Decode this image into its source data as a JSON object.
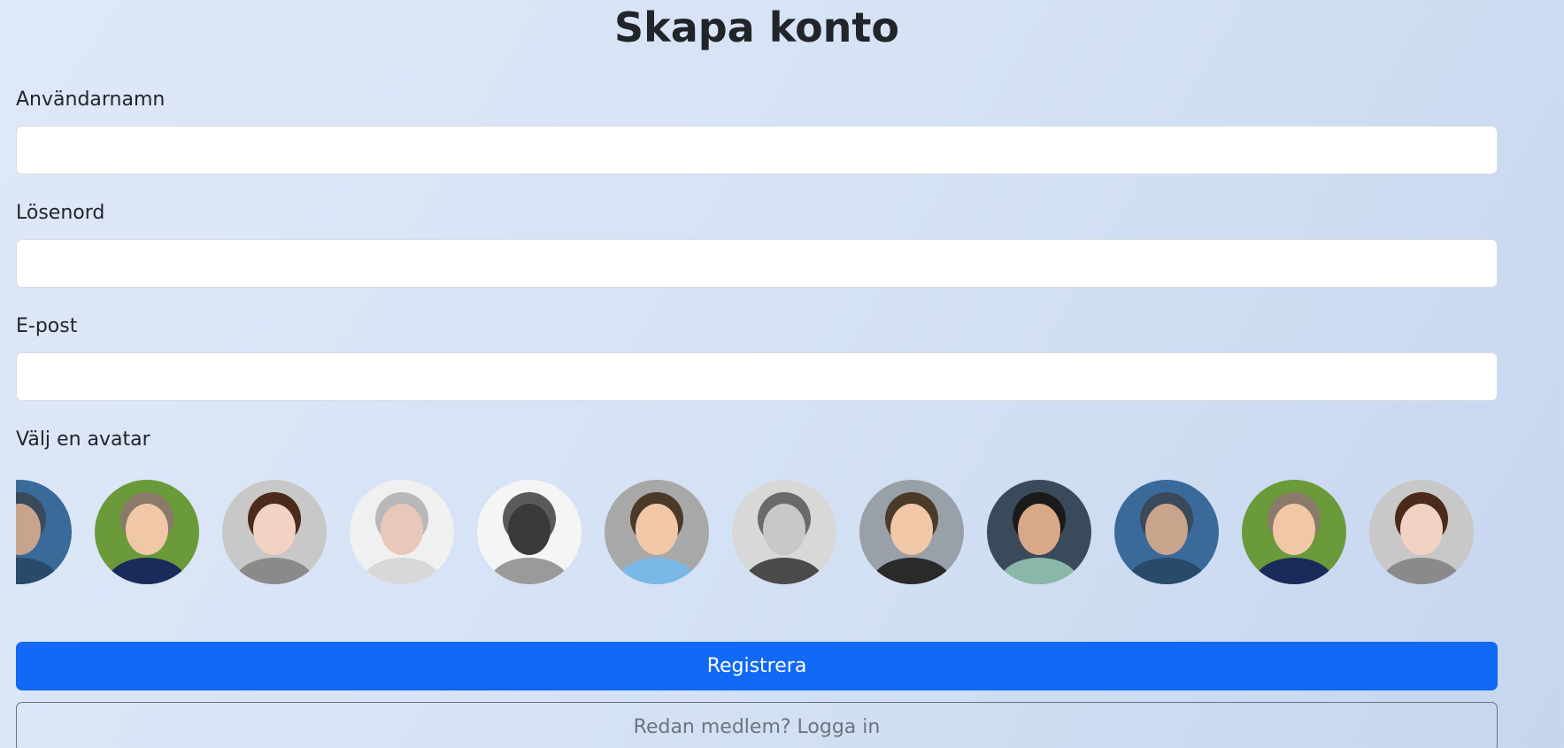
{
  "page": {
    "title": "Skapa konto"
  },
  "form": {
    "username": {
      "label": "Användarnamn",
      "value": "",
      "placeholder": ""
    },
    "password": {
      "label": "Lösenord",
      "value": "",
      "placeholder": ""
    },
    "email": {
      "label": "E-post",
      "value": "",
      "placeholder": ""
    },
    "avatar_label": "Välj en avatar",
    "avatars": [
      {
        "name": "avatar-bald-man-blue",
        "bg": "#3a6a9a",
        "skin": "#c9a48c",
        "hair": "#3a4a5a",
        "shirt": "#2a4a6a"
      },
      {
        "name": "avatar-boy-smiling",
        "bg": "#6a9a3a",
        "skin": "#f0c8a8",
        "hair": "#8a7a6a",
        "shirt": "#1a2a5a"
      },
      {
        "name": "avatar-woman-scarf",
        "bg": "#c8c8c8",
        "skin": "#f2d2c2",
        "hair": "#4a2a1a",
        "shirt": "#8a8a8a"
      },
      {
        "name": "avatar-man-funny-face",
        "bg": "#f0f0f0",
        "skin": "#e8c8b8",
        "hair": "#b8b8b8",
        "shirt": "#d8d8d8"
      },
      {
        "name": "avatar-man-cap-bw",
        "bg": "#f5f5f5",
        "skin": "#3a3a3a",
        "hair": "#5a5a5a",
        "shirt": "#9a9a9a"
      },
      {
        "name": "avatar-man-headphones",
        "bg": "#a8a8a8",
        "skin": "#f0c8a8",
        "hair": "#4a3a2a",
        "shirt": "#7ab8e8"
      },
      {
        "name": "avatar-woman-bw",
        "bg": "#d8d8d8",
        "skin": "#c8c8c8",
        "hair": "#6a6a6a",
        "shirt": "#4a4a4a"
      },
      {
        "name": "avatar-man-suit-group",
        "bg": "#9aa0a8",
        "skin": "#f0c8a8",
        "hair": "#4a3a2a",
        "shirt": "#2a2a2a"
      },
      {
        "name": "avatar-child-curly",
        "bg": "#3a4a5a",
        "skin": "#d8a888",
        "hair": "#1a1a1a",
        "shirt": "#8ab8a8"
      },
      {
        "name": "avatar-bald-man-blue-2",
        "bg": "#3a6a9a",
        "skin": "#c9a48c",
        "hair": "#3a4a5a",
        "shirt": "#2a4a6a"
      },
      {
        "name": "avatar-boy-smiling-2",
        "bg": "#6a9a3a",
        "skin": "#f0c8a8",
        "hair": "#8a7a6a",
        "shirt": "#1a2a5a"
      },
      {
        "name": "avatar-woman-scarf-2",
        "bg": "#c8c8c8",
        "skin": "#f2d2c2",
        "hair": "#4a2a1a",
        "shirt": "#8a8a8a"
      }
    ]
  },
  "actions": {
    "register_label": "Registrera",
    "login_label": "Redan medlem? Logga in"
  },
  "colors": {
    "primary": "#1169f5",
    "secondary": "#6c757d"
  }
}
